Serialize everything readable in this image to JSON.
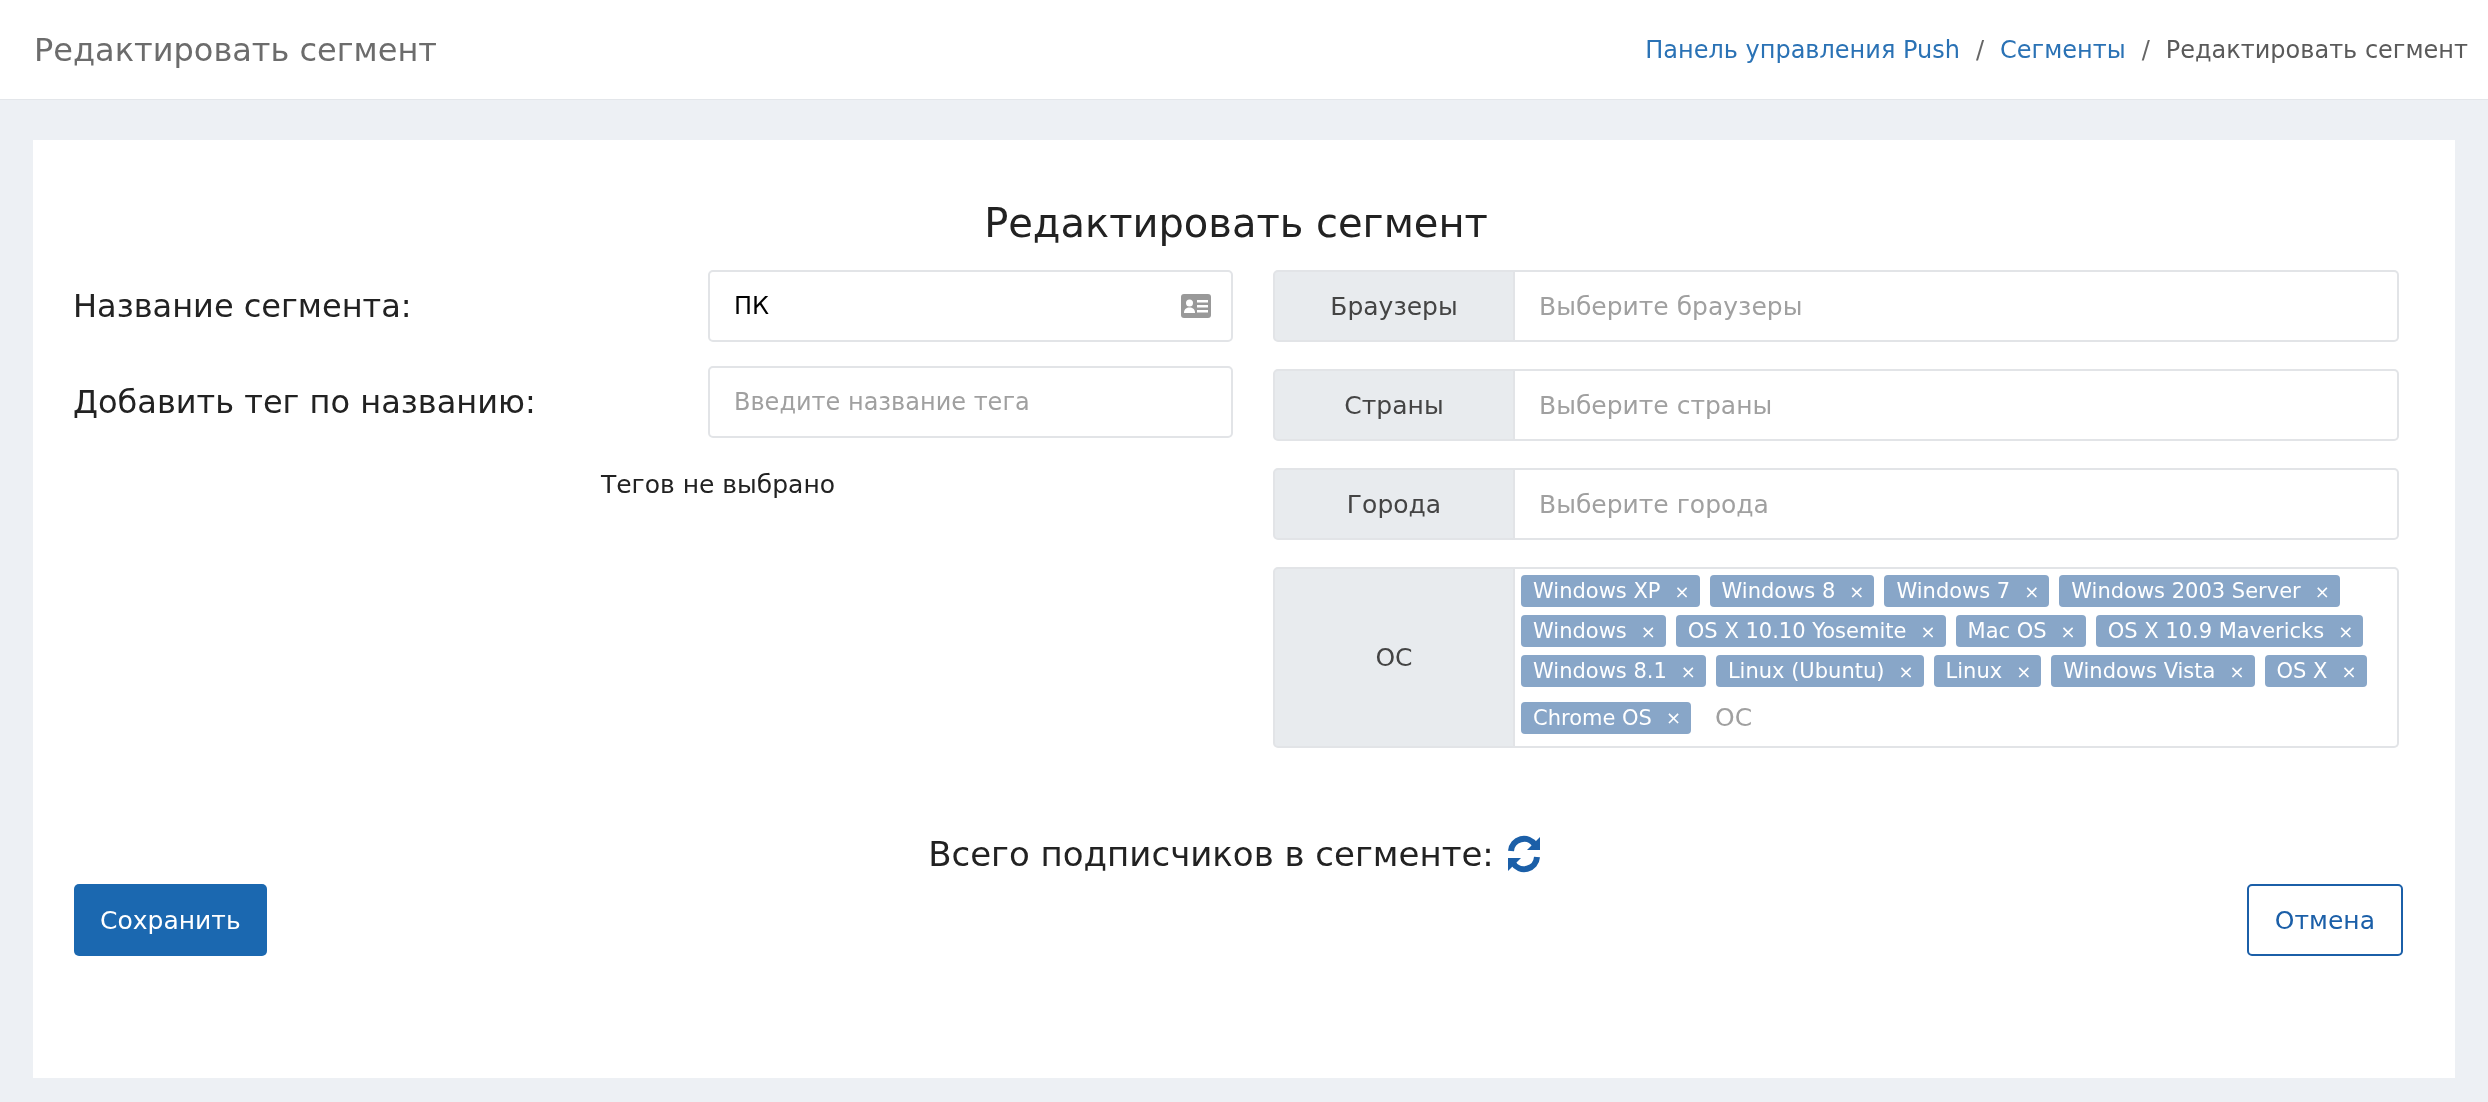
{
  "header": {
    "title": "Редактировать сегмент",
    "breadcrumbs": [
      {
        "label": "Панель управления Push",
        "link": true
      },
      {
        "label": "Сегменты",
        "link": true
      },
      {
        "label": "Редактировать сегмент",
        "link": false
      }
    ],
    "separator": "/"
  },
  "form": {
    "title": "Редактировать сегмент",
    "name_field": {
      "label": "Название сегмента:",
      "value": "ПК"
    },
    "tag_field": {
      "label": "Добавить тег по названию:",
      "placeholder": "Введите название тега"
    },
    "tags_empty": "Тегов не выбрано"
  },
  "filters": [
    {
      "label": "Браузеры",
      "placeholder": "Выберите браузеры"
    },
    {
      "label": "Страны",
      "placeholder": "Выберите страны"
    },
    {
      "label": "Города",
      "placeholder": "Выберите города"
    },
    {
      "label": "ОС",
      "placeholder": "ОС",
      "tags": [
        "Windows XP",
        "Windows 8",
        "Windows 7",
        "Windows 2003 Server",
        "Windows",
        "OS X 10.10 Yosemite",
        "Mac OS",
        "OS X 10.9 Mavericks",
        "Windows 8.1",
        "Linux (Ubuntu)",
        "Linux",
        "Windows Vista",
        "OS X",
        "Chrome OS"
      ]
    }
  ],
  "tag_remove": "×",
  "total": {
    "label": "Всего подписчиков в сегменте:"
  },
  "buttons": {
    "save": "Сохранить",
    "cancel": "Отмена"
  }
}
